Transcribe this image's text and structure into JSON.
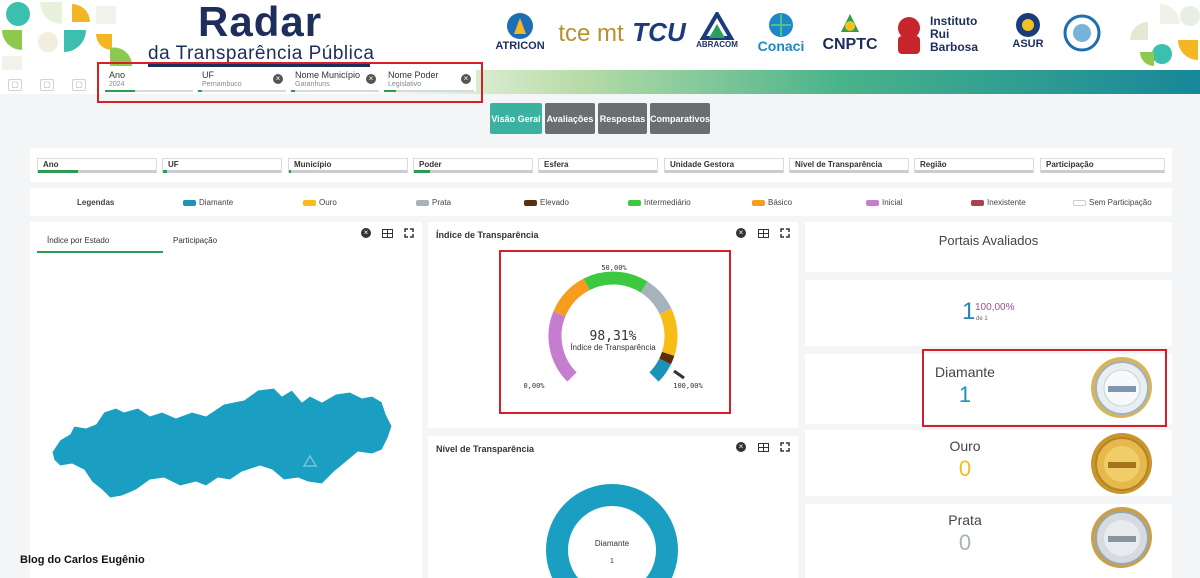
{
  "header": {
    "title": "Radar",
    "subtitle": "da Transparência Pública",
    "partner_logos": [
      {
        "name": "atricon-logo",
        "label": "ATRICON"
      },
      {
        "name": "tce-mt-logo",
        "label": "tce mt"
      },
      {
        "name": "tcu-logo",
        "label": "TCU"
      },
      {
        "name": "abracom-logo",
        "label": "ABRACOM"
      },
      {
        "name": "conaci-logo",
        "label": "Conaci"
      },
      {
        "name": "cnptc-logo",
        "label": "CNPTC"
      },
      {
        "name": "instituto-rui-barbosa-logo",
        "label": "Instituto Rui Barbosa"
      },
      {
        "name": "asur-logo",
        "label": "ASUR"
      },
      {
        "name": "seal-logo",
        "label": ""
      }
    ]
  },
  "active_filters": [
    {
      "label": "Ano",
      "value": "2024"
    },
    {
      "label": "UF",
      "value": "Pernambuco"
    },
    {
      "label": "Nome Município",
      "value": "Garanhuns"
    },
    {
      "label": "Nome Poder",
      "value": "Legislativo"
    }
  ],
  "tabs": [
    {
      "label": "Visão Geral",
      "active": true
    },
    {
      "label": "Avaliações",
      "active": false
    },
    {
      "label": "Respostas",
      "active": false
    },
    {
      "label": "Comparativos",
      "active": false
    }
  ],
  "filters": [
    {
      "label": "Ano"
    },
    {
      "label": "UF"
    },
    {
      "label": "Município"
    },
    {
      "label": "Poder"
    },
    {
      "label": "Esfera"
    },
    {
      "label": "Unidade Gestora"
    },
    {
      "label": "Nível de Transparência"
    },
    {
      "label": "Região"
    },
    {
      "label": "Participação"
    }
  ],
  "legend": {
    "title": "Legendas",
    "items": [
      {
        "label": "Diamante",
        "color": "#1a93b7"
      },
      {
        "label": "Ouro",
        "color": "#f7bd16"
      },
      {
        "label": "Prata",
        "color": "#a6b3bb"
      },
      {
        "label": "Elevado",
        "color": "#5b2e0e"
      },
      {
        "label": "Intermediário",
        "color": "#3cc940"
      },
      {
        "label": "Básico",
        "color": "#f79c1c"
      },
      {
        "label": "Inicial",
        "color": "#c67dd0"
      },
      {
        "label": "Inexistente",
        "color": "#a8424d"
      },
      {
        "label": "Sem Participação",
        "color": "#ffffff"
      }
    ]
  },
  "map_panel": {
    "tabs": [
      "Índice por Estado",
      "Participação"
    ],
    "map_color": "#1a9fc2"
  },
  "index_panel": {
    "title": "Índice de Transparência",
    "value": "98,31%",
    "caption": "Índice de Transparência",
    "min_label": "0,00%",
    "mid_label": "50,00%",
    "max_label": "100,00%"
  },
  "level_panel": {
    "title": "Nível de Transparência",
    "center_label": "Diamante",
    "center_value": "1"
  },
  "portals": {
    "title": "Portais Avaliados",
    "count": "1",
    "percent": "100,00%",
    "of_label": "de 1"
  },
  "medals": [
    {
      "label": "Diamante",
      "value": "1",
      "color": "#1a93b7"
    },
    {
      "label": "Ouro",
      "value": "0",
      "color": "#f7bd16"
    },
    {
      "label": "Prata",
      "value": "0",
      "color": "#a6b3bb"
    }
  ],
  "watermark": "Blog do Carlos Eugênio"
}
